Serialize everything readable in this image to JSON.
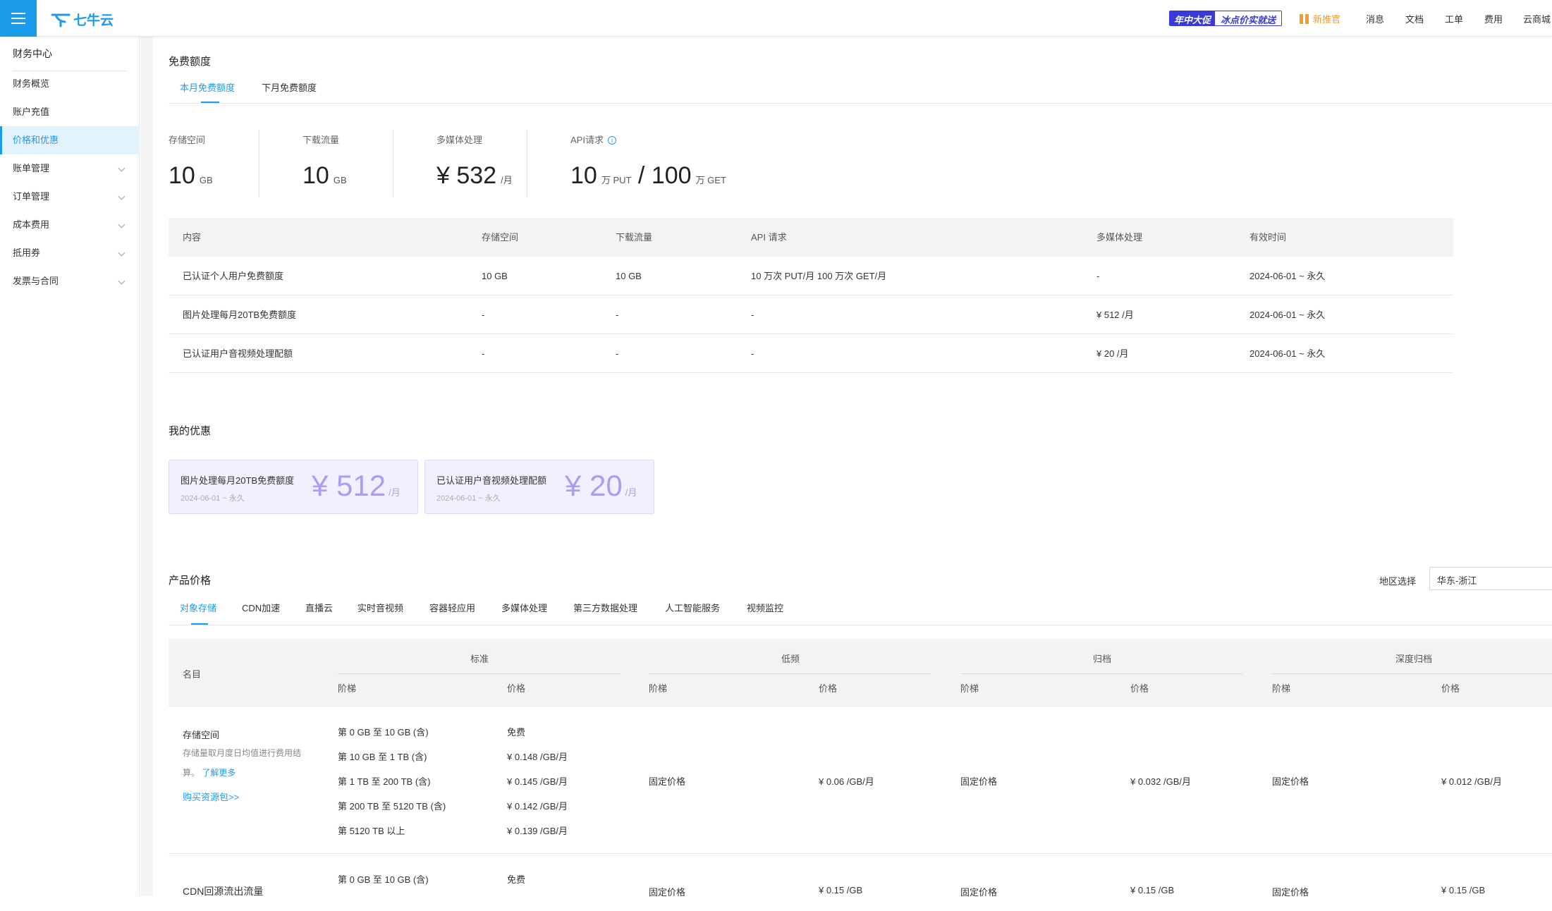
{
  "topbar": {
    "logo_text": "七牛云",
    "promo_left": "年中大促",
    "promo_right": "冰点价实就送",
    "gift_label": "新推官",
    "nav": [
      "消息",
      "文档",
      "工单",
      "费用",
      "云商城"
    ]
  },
  "sidebar": {
    "title": "财务中心",
    "items": [
      {
        "label": "财务概览",
        "expandable": false,
        "active": false
      },
      {
        "label": "账户充值",
        "expandable": false,
        "active": false
      },
      {
        "label": "价格和优惠",
        "expandable": false,
        "active": true
      },
      {
        "label": "账单管理",
        "expandable": true,
        "active": false
      },
      {
        "label": "订单管理",
        "expandable": true,
        "active": false
      },
      {
        "label": "成本费用",
        "expandable": true,
        "active": false
      },
      {
        "label": "抵用券",
        "expandable": true,
        "active": false
      },
      {
        "label": "发票与合同",
        "expandable": true,
        "active": false
      }
    ]
  },
  "free_quota": {
    "title": "免费额度",
    "tabs": [
      "本月免费额度",
      "下月免费额度"
    ],
    "active_tab": 0,
    "stats": {
      "storage": {
        "label": "存储空间",
        "value": "10",
        "unit": "GB"
      },
      "download": {
        "label": "下载流量",
        "value": "10",
        "unit": "GB"
      },
      "media": {
        "label": "多媒体处理",
        "value": "¥ 532",
        "unit": "/月"
      },
      "api": {
        "label": "API请求",
        "info_icon": "i",
        "put_value": "10",
        "put_unit": "万 PUT",
        "slash": "/",
        "get_value": "100",
        "get_unit": "万 GET"
      }
    },
    "table": {
      "headers": [
        "内容",
        "存储空间",
        "下载流量",
        "API 请求",
        "多媒体处理",
        "有效时间"
      ],
      "rows": [
        [
          "已认证个人用户免费额度",
          "10 GB",
          "10 GB",
          "10 万次 PUT/月 100 万次 GET/月",
          "-",
          "2024-06-01 ~ 永久"
        ],
        [
          "图片处理每月20TB免费额度",
          "-",
          "-",
          "-",
          "¥ 512 /月",
          "2024-06-01 ~ 永久"
        ],
        [
          "已认证用户音视频处理配额",
          "-",
          "-",
          "-",
          "¥ 20 /月",
          "2024-06-01 ~ 永久"
        ]
      ]
    }
  },
  "my_offers": {
    "title": "我的优惠",
    "cards": [
      {
        "name": "图片处理每月20TB免费额度",
        "date": "2024-06-01 ~ 永久",
        "amount": "¥ 512",
        "unit": "/月"
      },
      {
        "name": "已认证用户音视频处理配额",
        "date": "2024-06-01 ~ 永久",
        "amount": "¥ 20",
        "unit": "/月"
      }
    ]
  },
  "product_prices": {
    "title": "产品价格",
    "region_label": "地区选择",
    "region_value": "华东-浙江",
    "tabs": [
      "对象存储",
      "CDN加速",
      "直播云",
      "实时音视频",
      "容器轻应用",
      "多媒体处理",
      "第三方数据处理",
      "人工智能服务",
      "视频监控"
    ],
    "active_tab": 0,
    "table": {
      "name_header": "名目",
      "groups": [
        "标准",
        "低频",
        "归档",
        "深度归档"
      ],
      "sub_tier": "阶梯",
      "sub_price": "价格",
      "rows": [
        {
          "name": "存储空间",
          "note_1": "存储量取月度日均值进行费用结",
          "note_2": "算。",
          "note_link": "了解更多",
          "buy_link": "购买资源包>>",
          "standard_tiers": [
            {
              "tier": "第 0 GB 至 10 GB (含)",
              "price": "免费"
            },
            {
              "tier": "第 10 GB 至 1 TB (含)",
              "price": "¥ 0.148 /GB/月"
            },
            {
              "tier": "第 1 TB 至 200 TB (含)",
              "price": "¥ 0.145 /GB/月"
            },
            {
              "tier": "第 200 TB 至 5120 TB (含)",
              "price": "¥ 0.142 /GB/月"
            },
            {
              "tier": "第 5120 TB 以上",
              "price": "¥ 0.139 /GB/月"
            }
          ],
          "low_tier": "固定价格",
          "low_price": "¥ 0.06 /GB/月",
          "archive_tier": "固定价格",
          "archive_price": "¥ 0.032 /GB/月",
          "deep_tier": "固定价格",
          "deep_price": "¥ 0.012 /GB/月"
        },
        {
          "name": "CDN回源流出流量",
          "standard_tiers": [
            {
              "tier": "第 0 GB 至 10 GB (含)",
              "price": "免费"
            }
          ],
          "low_tier": "固定价格",
          "low_price": "¥ 0.15 /GB",
          "archive_tier": "固定价格",
          "archive_price": "¥ 0.15 /GB",
          "deep_tier": "固定价格",
          "deep_price": "¥ 0.15 /GB"
        }
      ]
    }
  },
  "colors": {
    "accent": "#1c9bea",
    "promo": "#3a3ad8",
    "coupon_bg": "#f2f0fe",
    "coupon_amount": "#a99ef0",
    "gift": "#f59a23"
  }
}
